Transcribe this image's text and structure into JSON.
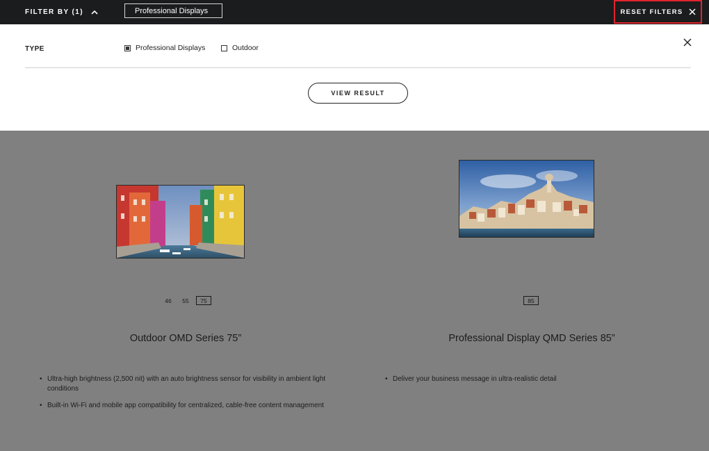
{
  "topbar": {
    "filter_by_label": "FILTER BY (1)",
    "active_chip": "Professional Displays",
    "reset_label": "RESET FILTERS"
  },
  "panel": {
    "type_label": "TYPE",
    "options": [
      {
        "label": "Professional Displays",
        "checked": true
      },
      {
        "label": "Outdoor",
        "checked": false
      }
    ],
    "view_result_label": "VIEW RESULT"
  },
  "products": [
    {
      "sizes": [
        "46",
        "55",
        "75"
      ],
      "selected_size": "75",
      "name": "Outdoor OMD Series 75”",
      "features": [
        "Ultra-high brightness (2,500 nit) with an auto brightness sensor for visibility in ambient light conditions",
        "Built-in Wi-Fi and mobile app compatibility for centralized, cable-free content management"
      ]
    },
    {
      "sizes": [
        "85"
      ],
      "selected_size": "85",
      "name": "Professional Display QMD Series 85”",
      "features": [
        "Deliver your business message in ultra-realistic detail"
      ]
    }
  ],
  "icons": {
    "filter_toggle": "chevron-up-icon",
    "reset": "close-icon",
    "panel_close": "close-icon"
  },
  "colors": {
    "topbar_bg": "#1b1c1e",
    "reset_outline": "#e3232c",
    "overlay_bg": "#808080"
  }
}
